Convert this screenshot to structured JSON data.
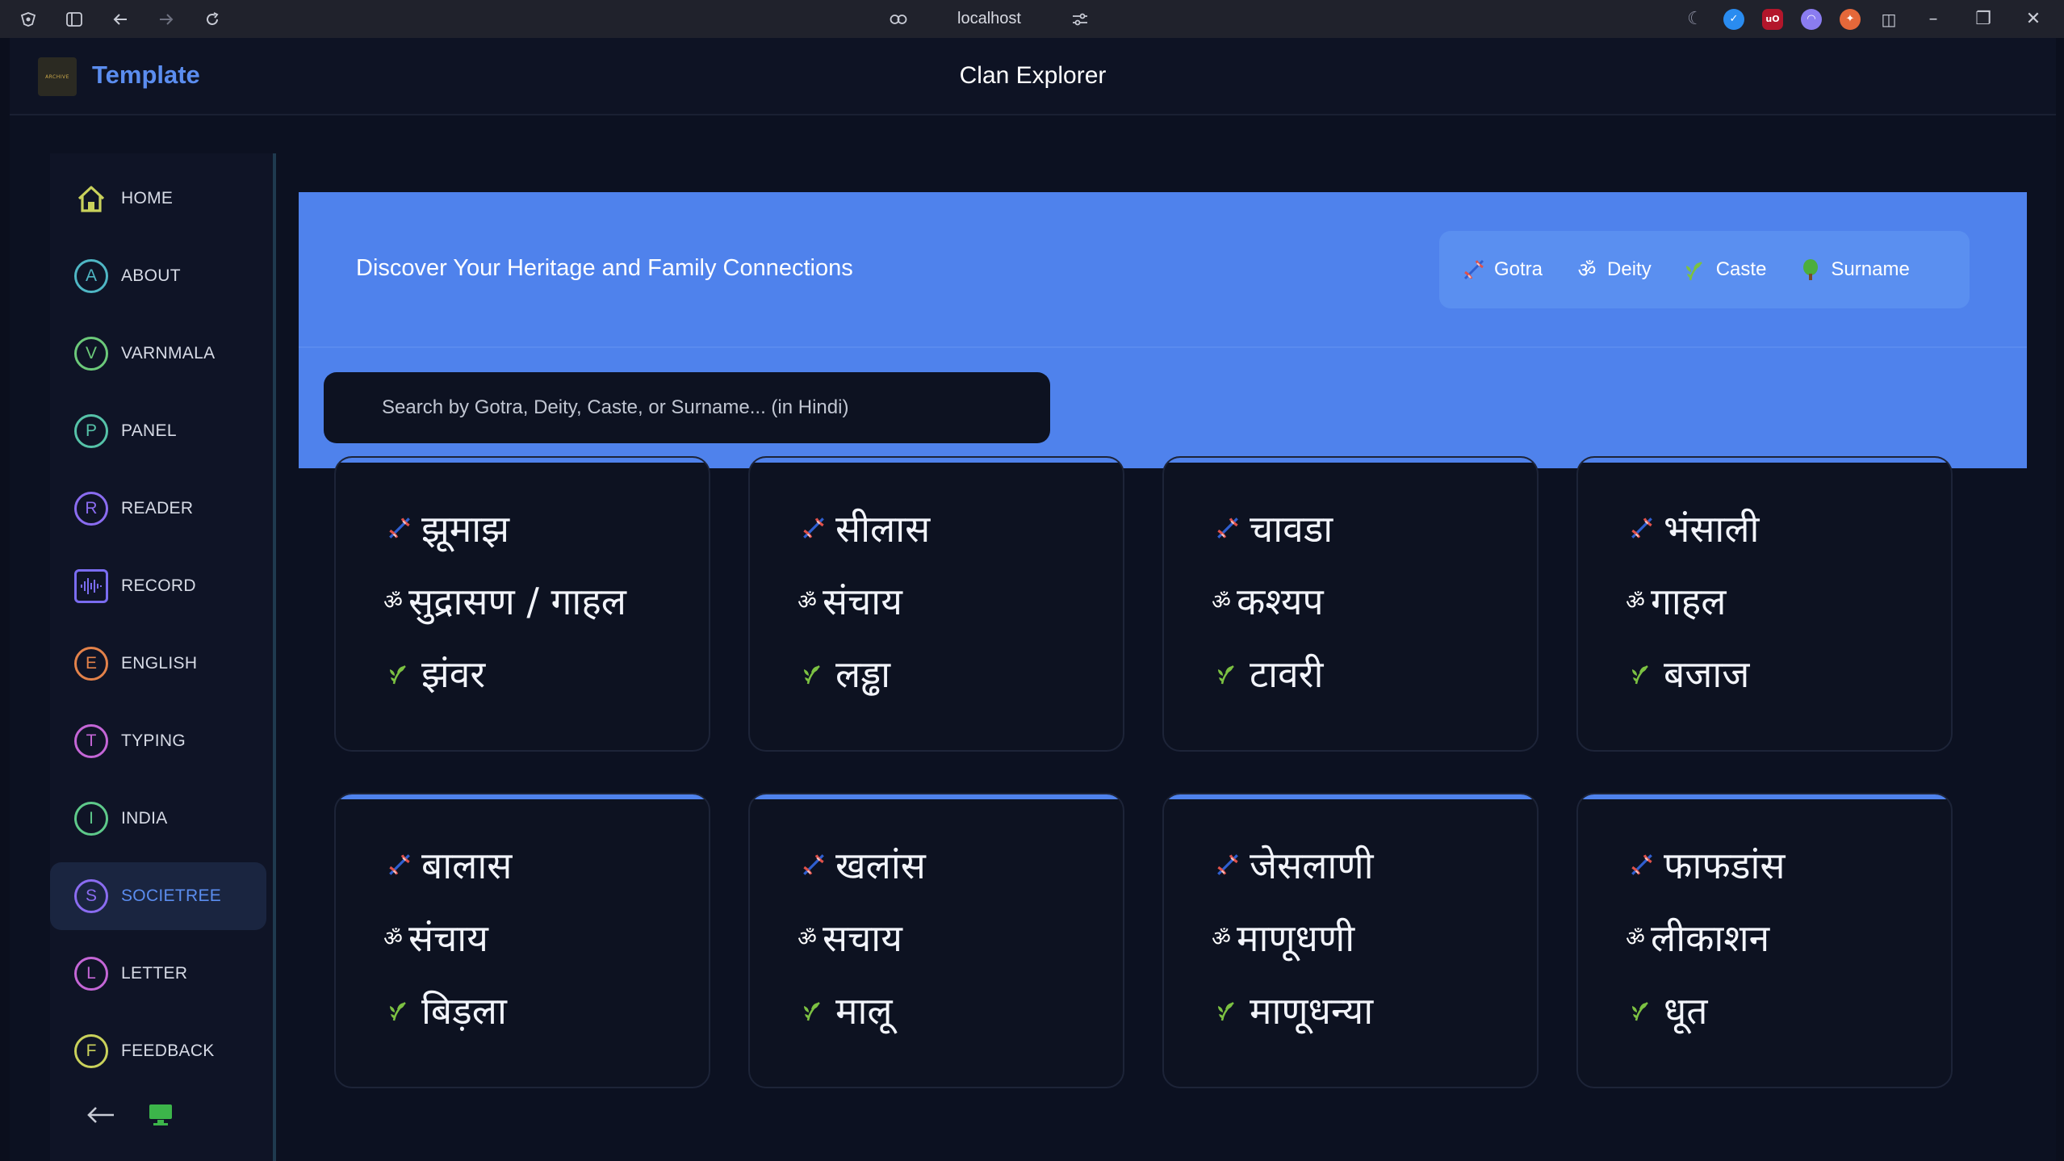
{
  "browser": {
    "url": "localhost"
  },
  "header": {
    "brand": "Template",
    "logo_text": "ARCHIVE",
    "title": "Clan Explorer"
  },
  "sidebar": {
    "items": [
      {
        "letter": "⌂",
        "label": "HOME",
        "color": "#c9d15b"
      },
      {
        "letter": "A",
        "label": "ABOUT",
        "color": "#4fb6c4"
      },
      {
        "letter": "V",
        "label": "VARNMALA",
        "color": "#6cc97a"
      },
      {
        "letter": "P",
        "label": "PANEL",
        "color": "#56c2a8"
      },
      {
        "letter": "R",
        "label": "READER",
        "color": "#8a6cf0"
      },
      {
        "letter": "≋",
        "label": "RECORD",
        "color": "#7a6cf0"
      },
      {
        "letter": "E",
        "label": "ENGLISH",
        "color": "#e3824a"
      },
      {
        "letter": "T",
        "label": "TYPING",
        "color": "#c466d6"
      },
      {
        "letter": "I",
        "label": "INDIA",
        "color": "#5ec98a"
      },
      {
        "letter": "S",
        "label": "SOCIETREE",
        "color": "#8a6cf0"
      },
      {
        "letter": "L",
        "label": "LETTER",
        "color": "#c466d6"
      },
      {
        "letter": "F",
        "label": "FEEDBACK",
        "color": "#c9d15b"
      }
    ],
    "active": "SOCIETREE"
  },
  "hero": {
    "heading": "Discover Your Heritage and Family Connections",
    "chips": [
      {
        "icon": "dna-icon",
        "label": "Gotra"
      },
      {
        "icon": "om-icon",
        "label": "Deity"
      },
      {
        "icon": "sprout-icon",
        "label": "Caste"
      },
      {
        "icon": "tree-icon",
        "label": "Surname"
      }
    ],
    "search_placeholder": "Search by Gotra, Deity, Caste, or Surname... (in Hindi)"
  },
  "cards": [
    {
      "gotra": "झूमाझ",
      "deity": "सुद्रासण / गाहल",
      "caste": "झंवर"
    },
    {
      "gotra": "सीलास",
      "deity": "संचाय",
      "caste": "लड्ढा"
    },
    {
      "gotra": "चावडा",
      "deity": "कश्यप",
      "caste": "टावरी"
    },
    {
      "gotra": "भंसाली",
      "deity": "गाहल",
      "caste": "बजाज"
    },
    {
      "gotra": "बालास",
      "deity": "संचाय",
      "caste": "बिड़ला"
    },
    {
      "gotra": "खलांस",
      "deity": "सचाय",
      "caste": "मालू"
    },
    {
      "gotra": "जेसलाणी",
      "deity": "माणूधणी",
      "caste": "माणूधन्या"
    },
    {
      "gotra": "फाफडांस",
      "deity": "लीकाशन",
      "caste": "धूत"
    }
  ],
  "colors": {
    "accent": "#4f82ec",
    "brand": "#5b8def",
    "background": "#0c1121"
  }
}
